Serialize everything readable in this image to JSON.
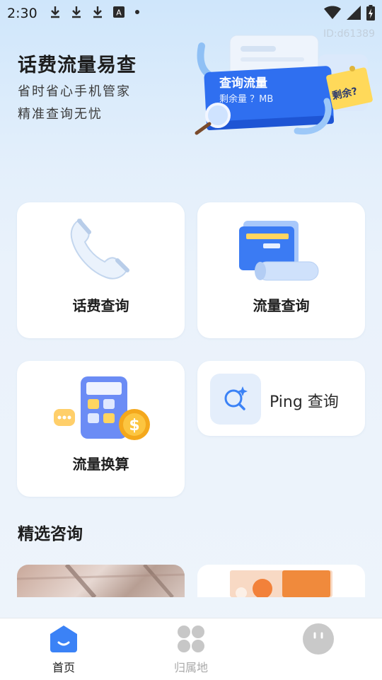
{
  "status_bar": {
    "time": "2:30",
    "left_icons": [
      "download-icon",
      "download-icon",
      "download-icon",
      "a-box-icon",
      "dot-icon"
    ],
    "right_icons": [
      "wifi-icon",
      "signal-icon",
      "battery-charging-icon"
    ]
  },
  "app_id": "ID:d61389",
  "hero": {
    "title": "话费流量易查",
    "subtitle_1": "省时省心手机管家",
    "subtitle_2": "精准查询无忧",
    "illustration": {
      "card_title": "查询流量",
      "card_sub": "剩余量 ？MB",
      "note_text": "剩余?"
    }
  },
  "features": [
    {
      "label": "话费查询",
      "icon": "phone-handset-icon"
    },
    {
      "label": "流量查询",
      "icon": "data-card-icon"
    },
    {
      "label": "流量换算",
      "icon": "calculator-icon"
    },
    {
      "label": "Ping 查询",
      "icon": "search-sparkle-icon"
    }
  ],
  "section": {
    "title": "精选咨询"
  },
  "bottom_nav": [
    {
      "label": "首页",
      "icon": "home-icon",
      "active": true
    },
    {
      "label": "归属地",
      "icon": "grid-icon",
      "active": false
    },
    {
      "label": "",
      "icon": "face-icon",
      "active": false
    }
  ],
  "colors": {
    "accent": "#3b82f6",
    "nav_active": "#1e1e1e",
    "nav_inactive": "#a9a9a9",
    "note_yellow": "#ffd95a"
  }
}
